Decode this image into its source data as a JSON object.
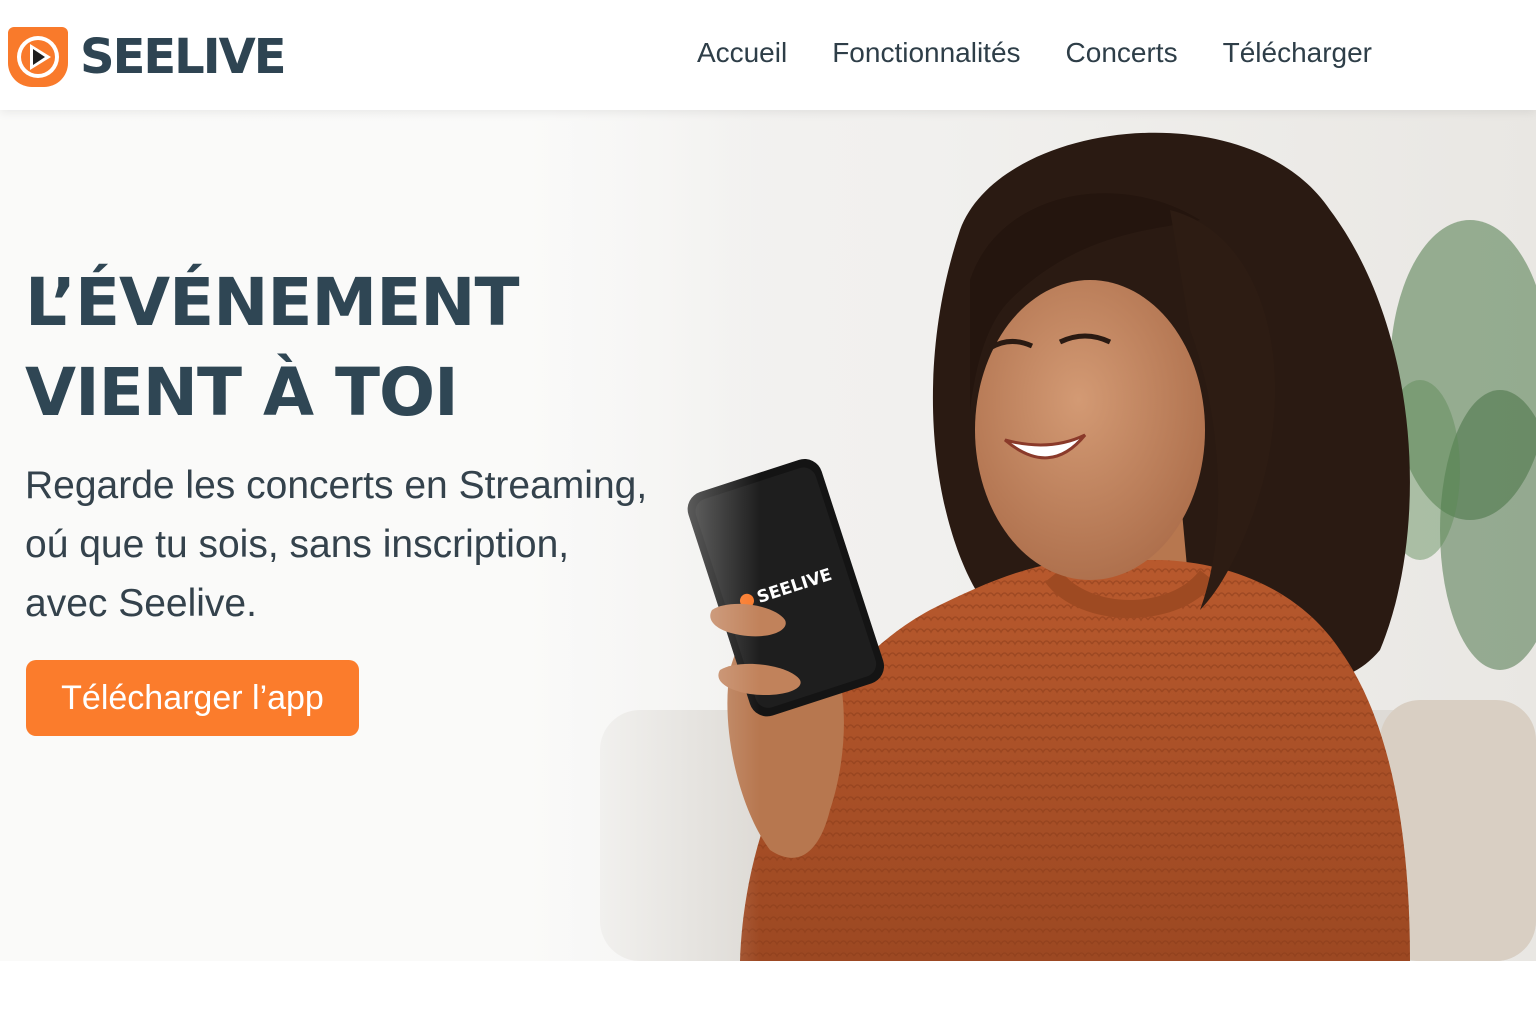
{
  "brand": {
    "name": "SEELIVE",
    "accent_color": "#f97a2b",
    "logo_icon": "play-icon"
  },
  "nav": {
    "items": [
      {
        "label": "Accueil"
      },
      {
        "label": "Fonctionnalités"
      },
      {
        "label": "Concerts"
      },
      {
        "label": "Télécharger"
      }
    ]
  },
  "hero": {
    "headline_line1": "L’ÉVÉNEMENT",
    "headline_line2": "VIENT À TOI",
    "subtext_line1": "Regarde les concerts en Streaming,",
    "subtext_line2": "oú que tu sois, sans inscription,",
    "subtext_line3": "avec Seelive.",
    "cta_label": "Télécharger l’app",
    "phone_screen_brand": "SEELIVE"
  },
  "colors": {
    "headline": "#2f4654",
    "cta": "#fb7c2c",
    "sweater": "#b0532a"
  }
}
